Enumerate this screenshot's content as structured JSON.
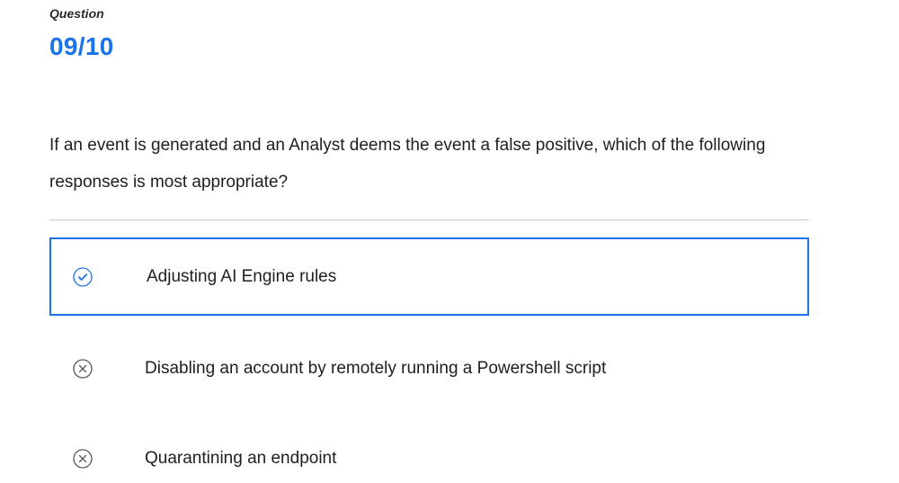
{
  "question": {
    "label": "Question",
    "number": "09/10",
    "text": "If an event is generated and an Analyst deems the event a false positive, which of the following responses is most appropriate?"
  },
  "answers": [
    {
      "label": "Adjusting AI Engine rules",
      "state": "correct",
      "icon": "check-circle-icon",
      "selected": true
    },
    {
      "label": "Disabling an account by remotely running a Powershell script",
      "state": "incorrect",
      "icon": "x-circle-icon",
      "selected": false
    },
    {
      "label": "Quarantining an endpoint",
      "state": "incorrect",
      "icon": "x-circle-icon",
      "selected": false
    }
  ],
  "colors": {
    "accent": "#1a73e8",
    "text": "#1f1f1f",
    "divider": "#c8c8c8",
    "icon_gray": "#555555"
  }
}
